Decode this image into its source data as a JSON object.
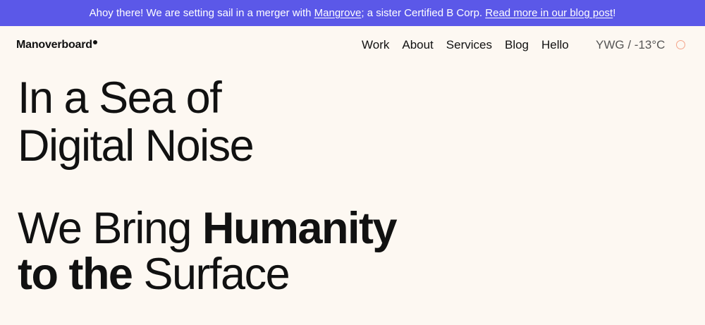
{
  "announcement": {
    "before": "Ahoy there! We are setting sail in a merger with ",
    "link1": "Mangrove",
    "middle": "; a sister Certified B Corp. ",
    "link2": "Read more in our blog post",
    "after": "!"
  },
  "brand": {
    "logo_text": "Manoverboard"
  },
  "nav": {
    "items": [
      "Work",
      "About",
      "Services",
      "Blog",
      "Hello"
    ]
  },
  "weather": {
    "text": "YWG / -13°C"
  },
  "hero": {
    "line1": "In a Sea of",
    "line2": "Digital Noise",
    "line3_regular": "We Bring ",
    "line3_bold": "Humanity",
    "line4_bold1": "to the ",
    "line4_bold2": "S",
    "line4_regular": "urface"
  },
  "colors": {
    "banner": "#5b58e8",
    "background": "#fdf8f2",
    "text": "#111111",
    "toggle_ring": "#f4a48a"
  },
  "icons": {
    "theme_toggle": "circle-outline-icon",
    "logo_mark": "dot-icon"
  }
}
